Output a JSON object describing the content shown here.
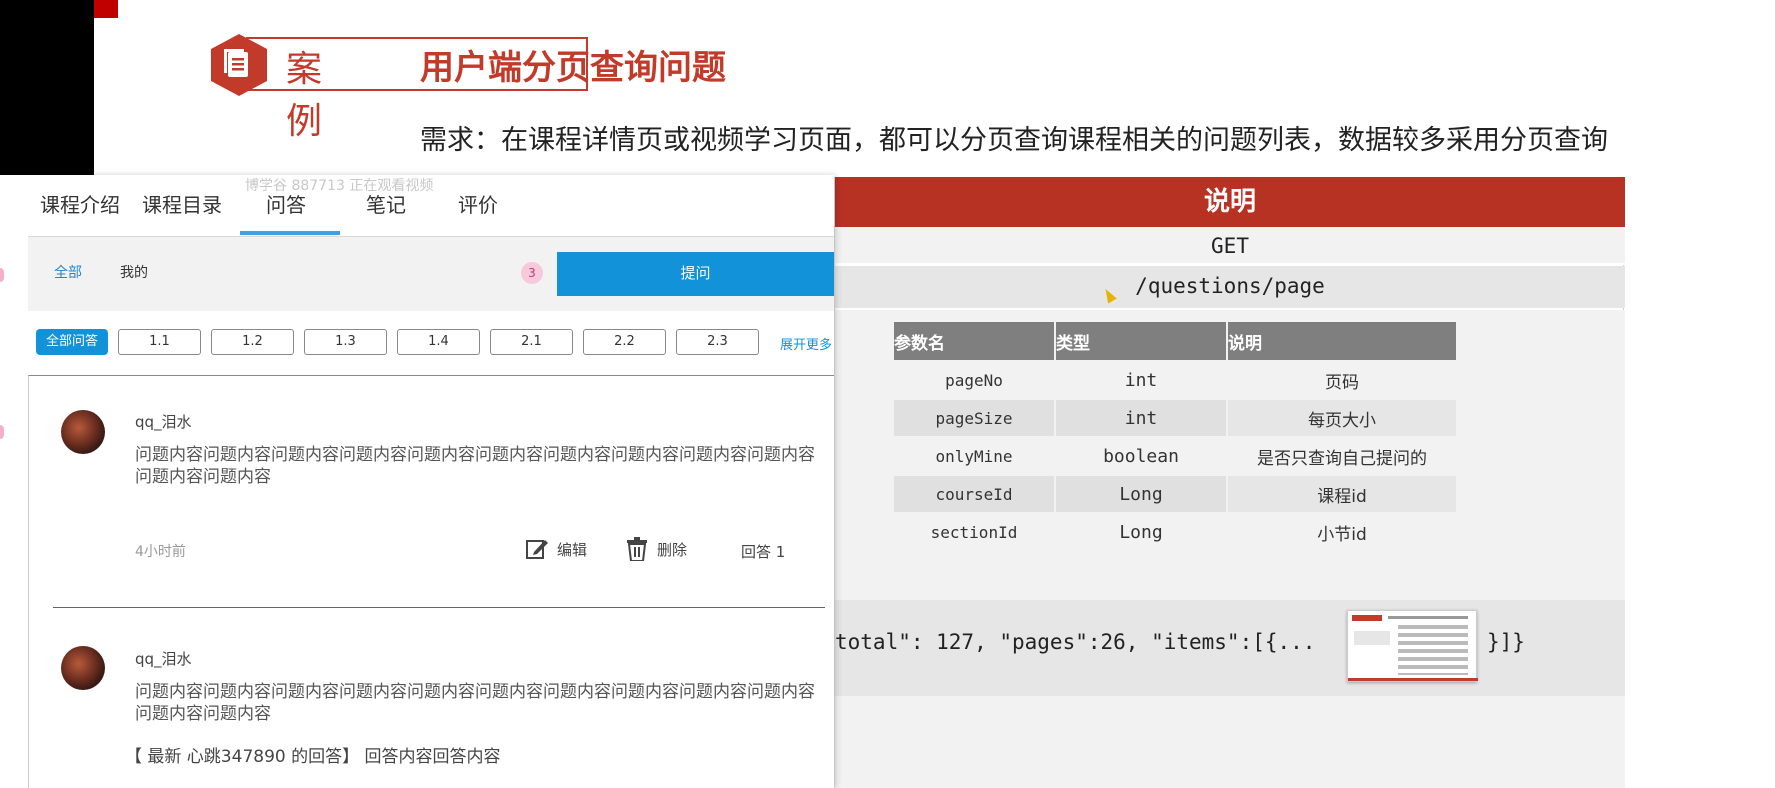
{
  "slide": {
    "badge_label": "案例",
    "title": "用户端分页查询问题",
    "requirement": "需求：在课程详情页或视频学习页面，都可以分页查询课程相关的问题列表，数据较多采用分页查询"
  },
  "app": {
    "watermark": "博学谷 887713 正在观看视频",
    "tabs": [
      {
        "label": "课程介绍"
      },
      {
        "label": "课程目录"
      },
      {
        "label": "问答"
      },
      {
        "label": "笔记"
      },
      {
        "label": "评价"
      }
    ],
    "active_tab": "问答",
    "filter": {
      "all_label": "全部",
      "mine_label": "我的",
      "count": "3",
      "ask_label": "提问"
    },
    "chapters": {
      "all_label": "全部问答",
      "items": [
        "1.1",
        "1.2",
        "1.3",
        "1.4",
        "2.1",
        "2.2",
        "2.3"
      ],
      "expand_label": "展开更多"
    },
    "questions": [
      {
        "user": "qq_泪水",
        "content": "问题内容问题内容问题内容问题内容问题内容问题内容问题内容问题内容问题内容问题内容问题内容问题内容",
        "time": "4小时前",
        "edit_label": "编辑",
        "delete_label": "删除",
        "answers_label": "回答 1"
      },
      {
        "user": "qq_泪水",
        "content": "问题内容问题内容问题内容问题内容问题内容问题内容问题内容问题内容问题内容问题内容问题内容问题内容",
        "reply": "【 最新 心跳347890 的回答】 回答内容回答内容"
      }
    ]
  },
  "spec": {
    "header": "说明",
    "method": "GET",
    "path": "/questions/page",
    "params_table": {
      "headers": [
        "参数名",
        "类型",
        "说明"
      ],
      "rows": [
        [
          "pageNo",
          "int",
          "页码"
        ],
        [
          "pageSize",
          "int",
          "每页大小"
        ],
        [
          "onlyMine",
          "boolean",
          "是否只查询自己提问的"
        ],
        [
          "courseId",
          "Long",
          "课程id"
        ],
        [
          "sectionId",
          "Long",
          "小节id"
        ]
      ]
    },
    "response_prefix": "total\": 127, \"pages\":26, \"items\":[{...",
    "response_suffix": "}]}"
  },
  "colors": {
    "accent_red": "#b83224",
    "primary_blue": "#1292d8",
    "table_header_gray": "#7f7f7f"
  }
}
